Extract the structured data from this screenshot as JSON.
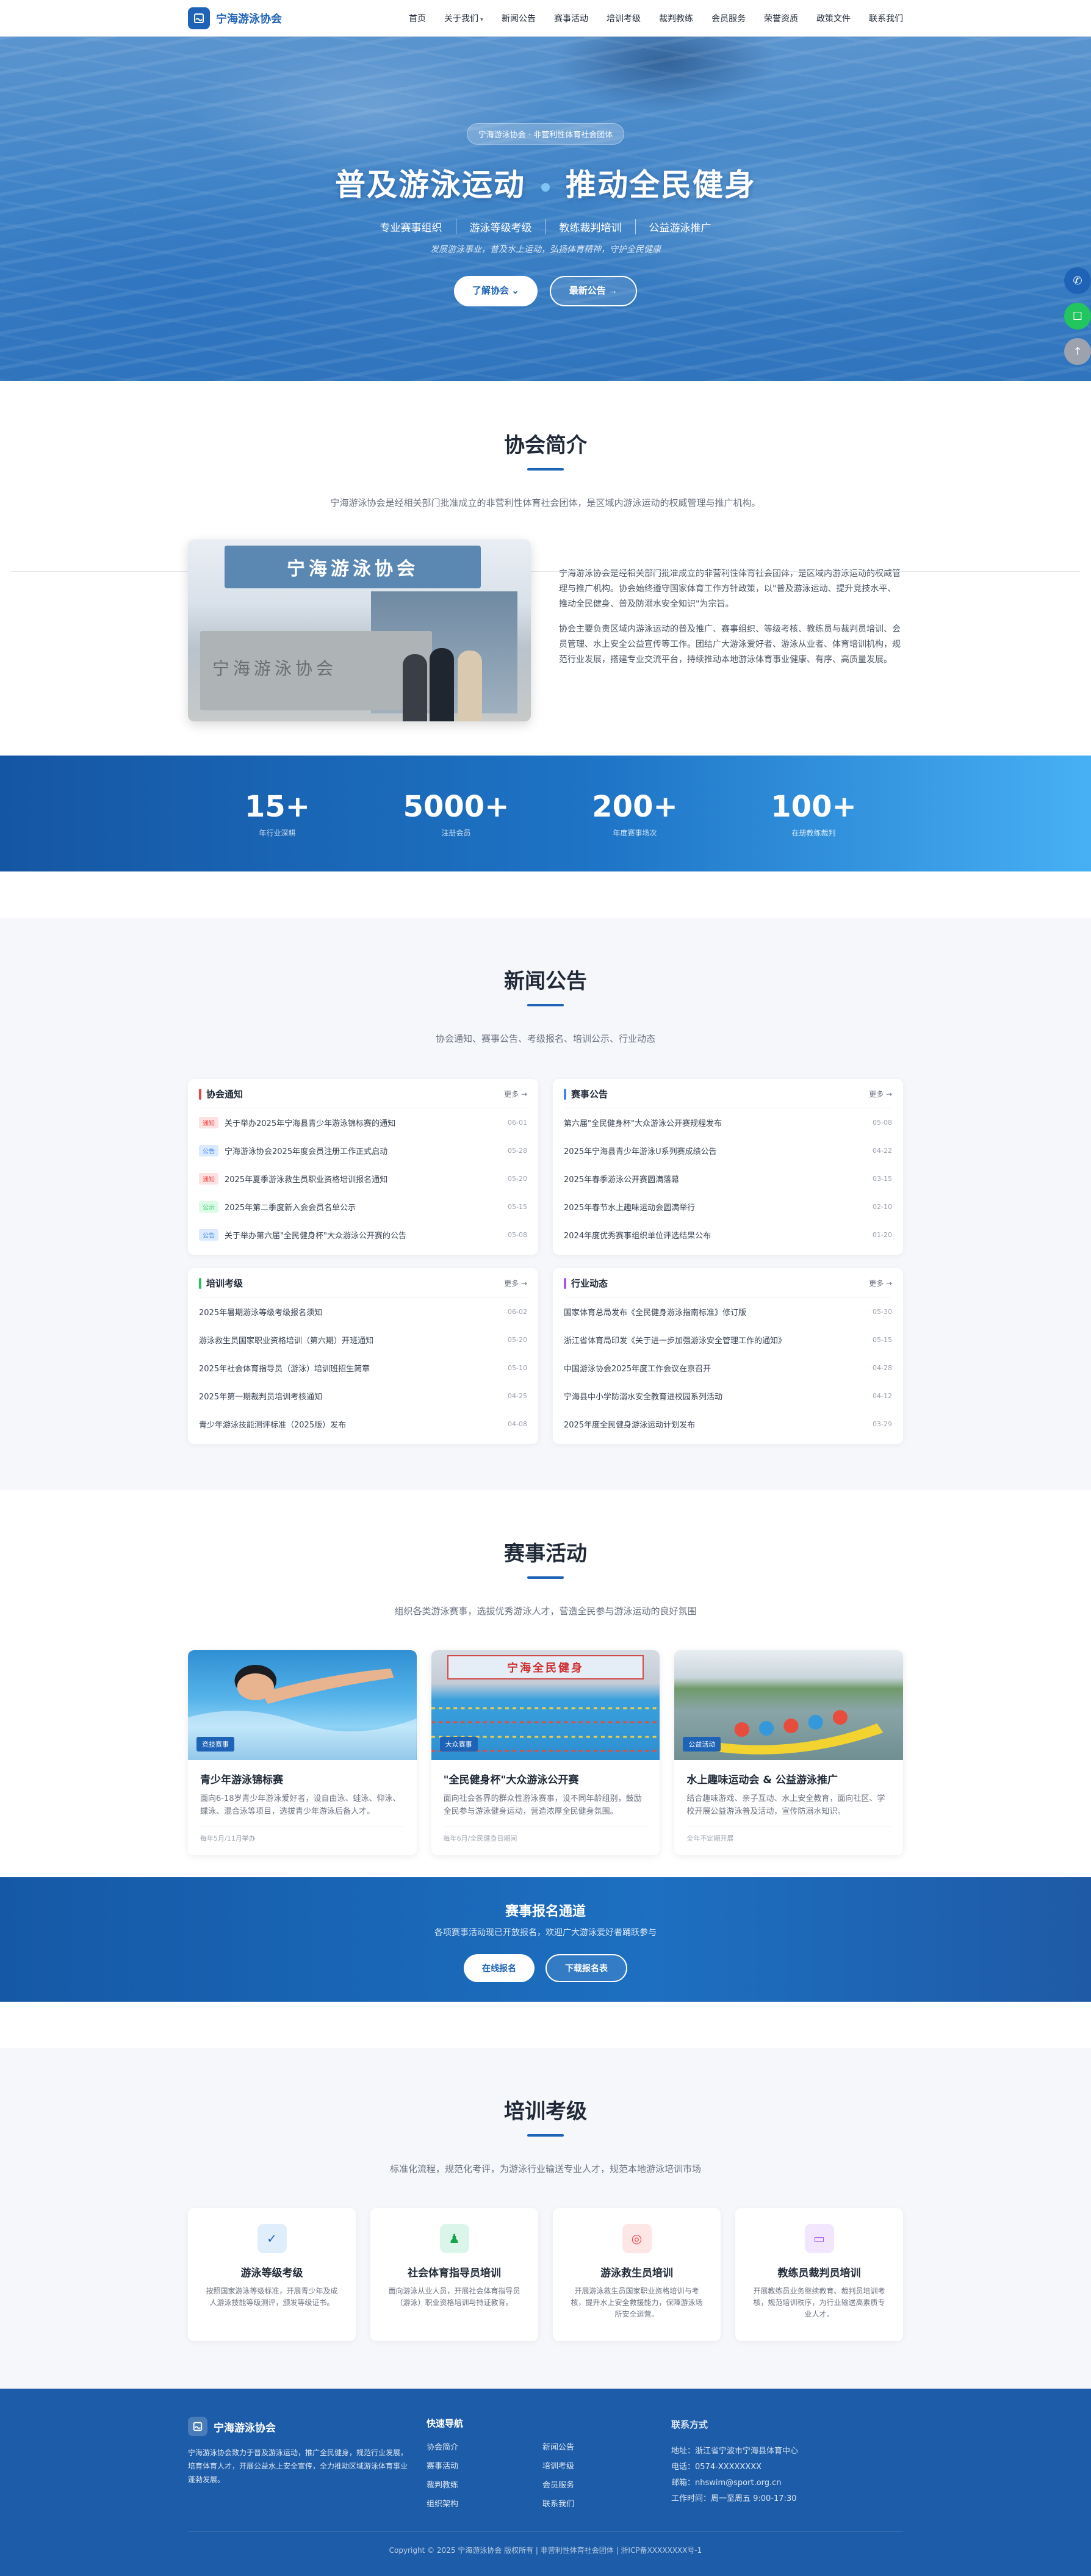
{
  "brand": {
    "name": "宁海游泳协会"
  },
  "nav": [
    "首页",
    "关于我们",
    "新闻公告",
    "赛事活动",
    "培训考级",
    "裁判教练",
    "会员服务",
    "荣誉资质",
    "政策文件",
    "联系我们"
  ],
  "hero": {
    "badge": "宁海游泳协会 · 非营利性体育社会团体",
    "title_left": "普及游泳运动",
    "title_right": "推动全民健身",
    "features": [
      "专业赛事组织",
      "游泳等级考级",
      "教练裁判培训",
      "公益游泳推广"
    ],
    "slogan": "发展游泳事业，普及水上运动，弘扬体育精神，守护全民健康",
    "btn_primary": "了解协会",
    "btn_secondary": "最新公告"
  },
  "colors": {
    "primary": "#1e63b6",
    "notice_red": "#ef4444",
    "blue_tag": "#3b82f6",
    "green_tag": "#22c55e",
    "purple": "#a855f7"
  },
  "about": {
    "title": "协会简介",
    "subtitle": "宁海游泳协会是经相关部门批准成立的非营利性体育社会团体，是区域内游泳运动的权威管理与推广机构。",
    "photo_sign": "宁海游泳协会",
    "photo_wall": "宁海游泳协会",
    "p1": "宁海游泳协会是经相关部门批准成立的非营利性体育社会团体，是区域内游泳运动的权威管理与推广机构。协会始终遵守国家体育工作方针政策，以\"普及游泳运动、提升竞技水平、推动全民健身、普及防溺水安全知识\"为宗旨。",
    "p2": "协会主要负责区域内游泳运动的普及推广、赛事组织、等级考核、教练员与裁判员培训、会员管理、水上安全公益宣传等工作。团结广大游泳爱好者、游泳从业者、体育培训机构，规范行业发展，搭建专业交流平台，持续推动本地游泳体育事业健康、有序、高质量发展。"
  },
  "stats": [
    {
      "num": "15+",
      "label": "年行业深耕"
    },
    {
      "num": "5000+",
      "label": "注册会员"
    },
    {
      "num": "200+",
      "label": "年度赛事场次"
    },
    {
      "num": "100+",
      "label": "在册教练裁判"
    }
  ],
  "news": {
    "title": "新闻公告",
    "subtitle": "协会通知、赛事公告、考级报名、培训公示、行业动态",
    "more": "更多 →",
    "cards": [
      {
        "title": "协会通知",
        "items": [
          {
            "tag": "通知",
            "text": "关于举办2025年宁海县青少年游泳锦标赛的通知",
            "date": "06-01"
          },
          {
            "tag": "公告",
            "text": "宁海游泳协会2025年度会员注册工作正式启动",
            "date": "05-28"
          },
          {
            "tag": "通知",
            "text": "2025年夏季游泳救生员职业资格培训报名通知",
            "date": "05-20"
          },
          {
            "tag": "公示",
            "text": "2025年第二季度新入会会员名单公示",
            "date": "05-15"
          },
          {
            "tag": "公告",
            "text": "关于举办第六届\"全民健身杯\"大众游泳公开赛的公告",
            "date": "05-08"
          }
        ]
      },
      {
        "title": "赛事公告",
        "items": [
          {
            "text": "第六届\"全民健身杯\"大众游泳公开赛规程发布",
            "date": "05-08"
          },
          {
            "text": "2025年宁海县青少年游泳U系列赛成绩公告",
            "date": "04-22"
          },
          {
            "text": "2025年春季游泳公开赛圆满落幕",
            "date": "03-15"
          },
          {
            "text": "2025年春节水上趣味运动会圆满举行",
            "date": "02-10"
          },
          {
            "text": "2024年度优秀赛事组织单位评选结果公布",
            "date": "01-20"
          }
        ]
      },
      {
        "title": "培训考级",
        "items": [
          {
            "text": "2025年暑期游泳等级考级报名须知",
            "date": "06-02"
          },
          {
            "text": "游泳救生员国家职业资格培训（第六期）开班通知",
            "date": "05-20"
          },
          {
            "text": "2025年社会体育指导员（游泳）培训班招生简章",
            "date": "05-10"
          },
          {
            "text": "2025年第一期裁判员培训考核通知",
            "date": "04-25"
          },
          {
            "text": "青少年游泳技能测评标准（2025版）发布",
            "date": "04-08"
          }
        ]
      },
      {
        "title": "行业动态",
        "items": [
          {
            "text": "国家体育总局发布《全民健身游泳指南标准》修订版",
            "date": "05-30"
          },
          {
            "text": "浙江省体育局印发《关于进一步加强游泳安全管理工作的通知》",
            "date": "05-15"
          },
          {
            "text": "中国游泳协会2025年度工作会议在京召开",
            "date": "04-28"
          },
          {
            "text": "宁海县中小学防溺水安全教育进校园系列活动",
            "date": "04-12"
          },
          {
            "text": "2025年度全民健身游泳运动计划发布",
            "date": "03-29"
          }
        ]
      }
    ]
  },
  "events": {
    "title": "赛事活动",
    "subtitle": "组织各类游泳赛事，选拔优秀游泳人才，营造全民参与游泳运动的良好氛围",
    "items": [
      {
        "tag": "竞技赛事",
        "title": "青少年游泳锦标赛",
        "desc": "面向6-18岁青少年游泳爱好者，设自由泳、蛙泳、仰泳、蝶泳、混合泳等项目，选拔青少年游泳后备人才。",
        "foot": "每年5月/11月举办"
      },
      {
        "tag": "大众赛事",
        "title": "\"全民健身杯\"大众游泳公开赛",
        "desc": "面向社会各界的群众性游泳赛事，设不同年龄组别，鼓励全民参与游泳健身运动，营造浓厚全民健身氛围。",
        "foot": "每年6月/全民健身日期间",
        "banner": "宁海全民健身"
      },
      {
        "tag": "公益活动",
        "title": "水上趣味运动会 & 公益游泳推广",
        "desc": "结合趣味游戏、亲子互动、水上安全教育，面向社区、学校开展公益游泳普及活动，宣传防溺水知识。",
        "foot": "全年不定期开展"
      }
    ]
  },
  "signup": {
    "title": "赛事报名通道",
    "desc": "各项赛事活动现已开放报名，欢迎广大游泳爱好者踊跃参与",
    "btn_online": "在线报名",
    "btn_download": "下载报名表"
  },
  "training": {
    "title": "培训考级",
    "subtitle": "标准化流程，规范化考评，为游泳行业输送专业人才，规范本地游泳培训市场",
    "items": [
      {
        "icon": "badge-check-icon",
        "title": "游泳等级考级",
        "desc": "按照国家游泳等级标准，开展青少年及成人游泳技能等级测评，颁发等级证书。"
      },
      {
        "icon": "instructor-icon",
        "title": "社会体育指导员培训",
        "desc": "面向游泳从业人员，开展社会体育指导员（游泳）职业资格培训与持证教育。"
      },
      {
        "icon": "lifebuoy-icon",
        "title": "游泳救生员培训",
        "desc": "开展游泳救生员国家职业资格培训与考核，提升水上安全救援能力，保障游泳场所安全运营。"
      },
      {
        "icon": "book-icon",
        "title": "教练员裁判员培训",
        "desc": "开展教练员业务继续教育、裁判员培训考核，规范培训秩序，为行业输送高素质专业人才。"
      }
    ]
  },
  "footer": {
    "desc": "宁海游泳协会致力于普及游泳运动，推广全民健身，规范行业发展，培育体育人才，开展公益水上安全宣传，全力推动区域游泳体育事业蓬勃发展。",
    "nav_title": "快速导航",
    "links": [
      "协会简介",
      "新闻公告",
      "赛事活动",
      "培训考级",
      "裁判教练",
      "会员服务",
      "组织架构",
      "联系我们"
    ],
    "contact_title": "联系方式",
    "contact": [
      "地址：浙江省宁波市宁海县体育中心",
      "电话：0574-XXXXXXXX",
      "邮箱：nhswim@sport.org.cn",
      "工作时间：周一至周五 9:00-17:30"
    ],
    "copyright": "Copyright © 2025 宁海游泳协会 版权所有 | 非营利性体育社会团体 | 浙ICP备XXXXXXXX号-1"
  }
}
